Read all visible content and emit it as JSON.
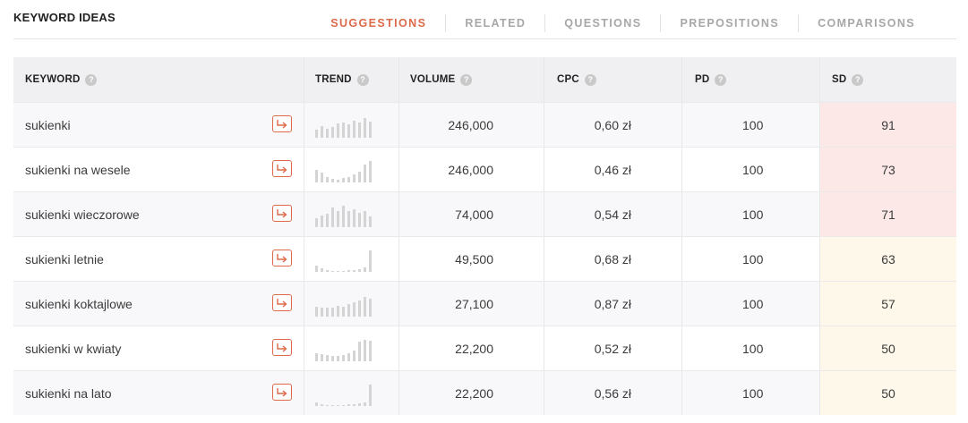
{
  "header": {
    "title": "KEYWORD IDEAS",
    "tabs": [
      {
        "label": "SUGGESTIONS",
        "active": true
      },
      {
        "label": "RELATED",
        "active": false
      },
      {
        "label": "QUESTIONS",
        "active": false
      },
      {
        "label": "PREPOSITIONS",
        "active": false
      },
      {
        "label": "COMPARISONS",
        "active": false
      }
    ]
  },
  "table": {
    "columns": {
      "keyword": "KEYWORD",
      "trend": "TREND",
      "volume": "VOLUME",
      "cpc": "CPC",
      "pd": "PD",
      "sd": "SD"
    },
    "rows": [
      {
        "keyword": "sukienki",
        "trend": [
          9,
          13,
          10,
          12,
          16,
          17,
          15,
          19,
          17,
          22,
          18
        ],
        "volume": "246,000",
        "cpc": "0,60 zł",
        "pd": "100",
        "sd": "91",
        "sd_level": "high"
      },
      {
        "keyword": "sukienki na wesele",
        "trend": [
          14,
          11,
          6,
          4,
          3,
          5,
          6,
          9,
          12,
          20,
          24
        ],
        "volume": "246,000",
        "cpc": "0,46 zł",
        "pd": "100",
        "sd": "73",
        "sd_level": "high"
      },
      {
        "keyword": "sukienki wieczorowe",
        "trend": [
          10,
          13,
          15,
          22,
          18,
          24,
          18,
          20,
          16,
          18,
          12
        ],
        "volume": "74,000",
        "cpc": "0,54 zł",
        "pd": "100",
        "sd": "71",
        "sd_level": "high"
      },
      {
        "keyword": "sukienki letnie",
        "trend": [
          7,
          4,
          2,
          1,
          1,
          1,
          2,
          2,
          3,
          5,
          24
        ],
        "volume": "49,500",
        "cpc": "0,68 zł",
        "pd": "100",
        "sd": "63",
        "sd_level": "medium"
      },
      {
        "keyword": "sukienki koktajlowe",
        "trend": [
          11,
          10,
          10,
          10,
          12,
          11,
          14,
          16,
          18,
          22,
          20
        ],
        "volume": "27,100",
        "cpc": "0,87 zł",
        "pd": "100",
        "sd": "57",
        "sd_level": "medium"
      },
      {
        "keyword": "sukienki w kwiaty",
        "trend": [
          9,
          8,
          7,
          6,
          6,
          7,
          9,
          12,
          22,
          24,
          23
        ],
        "volume": "22,200",
        "cpc": "0,52 zł",
        "pd": "100",
        "sd": "50",
        "sd_level": "medium"
      },
      {
        "keyword": "sukienki na lato",
        "trend": [
          4,
          2,
          1,
          1,
          1,
          1,
          2,
          2,
          3,
          4,
          24
        ],
        "volume": "22,200",
        "cpc": "0,56 zł",
        "pd": "100",
        "sd": "50",
        "sd_level": "medium"
      }
    ]
  },
  "colors": {
    "accent": "#dd6a4a",
    "sd_high_bg": "#fde8e8",
    "sd_medium_bg": "#fef8ea",
    "trend_bar": "#d4d4d4"
  },
  "icons": {
    "goto": "arrow-right-boxed-icon",
    "help": "question-circle-icon"
  }
}
